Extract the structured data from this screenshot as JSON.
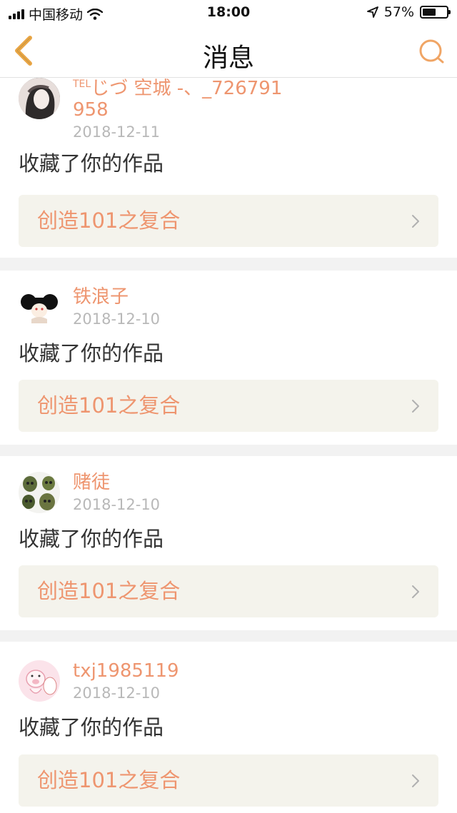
{
  "status_bar": {
    "carrier": "中国移动",
    "time": "18:00",
    "battery_percent": "57%",
    "battery_level": 0.57,
    "icons": [
      "signal-icon",
      "wifi-icon",
      "location-arrow-icon",
      "battery-icon"
    ]
  },
  "nav": {
    "title": "消息",
    "back_icon": "chevron-left-icon",
    "search_icon": "search-icon",
    "accent_color": "#e9a545"
  },
  "colors": {
    "accent": "#ee956f",
    "link_bg": "#f4f3ec",
    "date": "#b8b8b8",
    "separator": "#f2f2f2"
  },
  "messages": [
    {
      "username_prefix": "TEL",
      "username": "じづ 空城 -、_726791958",
      "date": "2018-12-11",
      "action": "收藏了你的作品",
      "work_title": "创造101之复合"
    },
    {
      "username": "铁浪子",
      "date": "2018-12-10",
      "action": "收藏了你的作品",
      "work_title": "创造101之复合"
    },
    {
      "username": "赌徒",
      "date": "2018-12-10",
      "action": "收藏了你的作品",
      "work_title": "创造101之复合"
    },
    {
      "username": "txj1985119",
      "date": "2018-12-10",
      "action": "收藏了你的作品",
      "work_title": "创造101之复合"
    }
  ]
}
